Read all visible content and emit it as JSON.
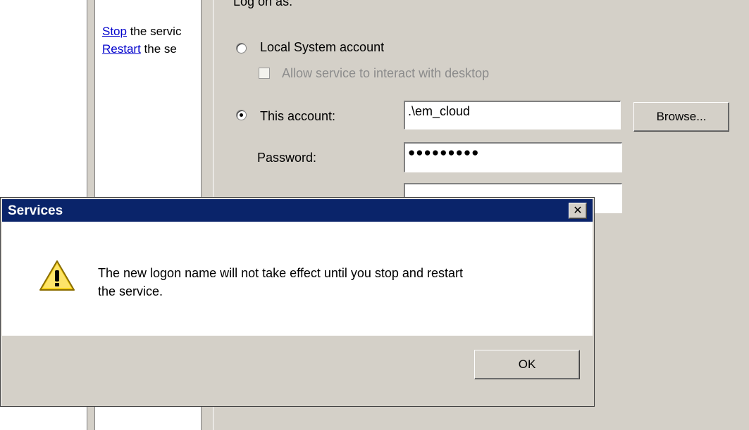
{
  "task_pane": {
    "stop_link": "Stop",
    "stop_rest": " the servic",
    "restart_link": "Restart",
    "restart_rest": " the se"
  },
  "logon": {
    "heading": "Log on as:",
    "local_system_label": "Local System account",
    "interact_desktop_label": "Allow service to interact with desktop",
    "this_account_label": "This account:",
    "account_value": ".\\em_cloud",
    "browse_label": "Browse...",
    "password_label": "Password:",
    "password_value": "●●●●●●●●●",
    "confirm_value": ""
  },
  "message_box": {
    "title": "Services",
    "close_glyph": "✕",
    "message_line1": "The new logon name will not take effect until you stop and restart",
    "message_line2": "the service.",
    "ok_label": "OK",
    "icon": "warning-icon"
  }
}
